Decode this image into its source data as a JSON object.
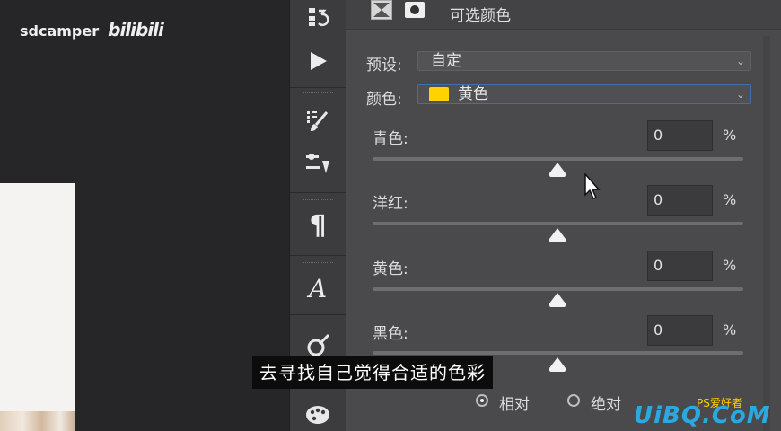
{
  "watermark": {
    "user": "sdcamper",
    "brand": "bilibili"
  },
  "panel": {
    "title": "可选颜色",
    "preset": {
      "label": "预设:",
      "value": "自定"
    },
    "colors": {
      "label": "颜色:",
      "value": "黄色",
      "swatch": "#ffd200"
    },
    "rows": [
      {
        "label": "青色:",
        "value": "0",
        "unit": "%",
        "slider": 0.5
      },
      {
        "label": "洋红:",
        "value": "0",
        "unit": "%",
        "slider": 0.5
      },
      {
        "label": "黄色:",
        "value": "0",
        "unit": "%",
        "slider": 0.5
      },
      {
        "label": "黑色:",
        "value": "0",
        "unit": "%",
        "slider": 0.5
      }
    ],
    "method": {
      "relative": "相对",
      "absolute": "绝对",
      "selected": "relative"
    }
  },
  "toolbar": {
    "icons": [
      "layer-comps-icon",
      "play-icon",
      "brush-settings-icon",
      "adjustments-icon",
      "paragraph-icon",
      "character-icon",
      "clone-source-icon",
      "color-palette-icon"
    ],
    "paragraph_glyph": "¶",
    "character_glyph": "A"
  },
  "subtitle": "去寻找自己觉得合适的色彩",
  "corner_watermark": {
    "text": "UiBQ.CoM",
    "small": "PS爱好者"
  }
}
